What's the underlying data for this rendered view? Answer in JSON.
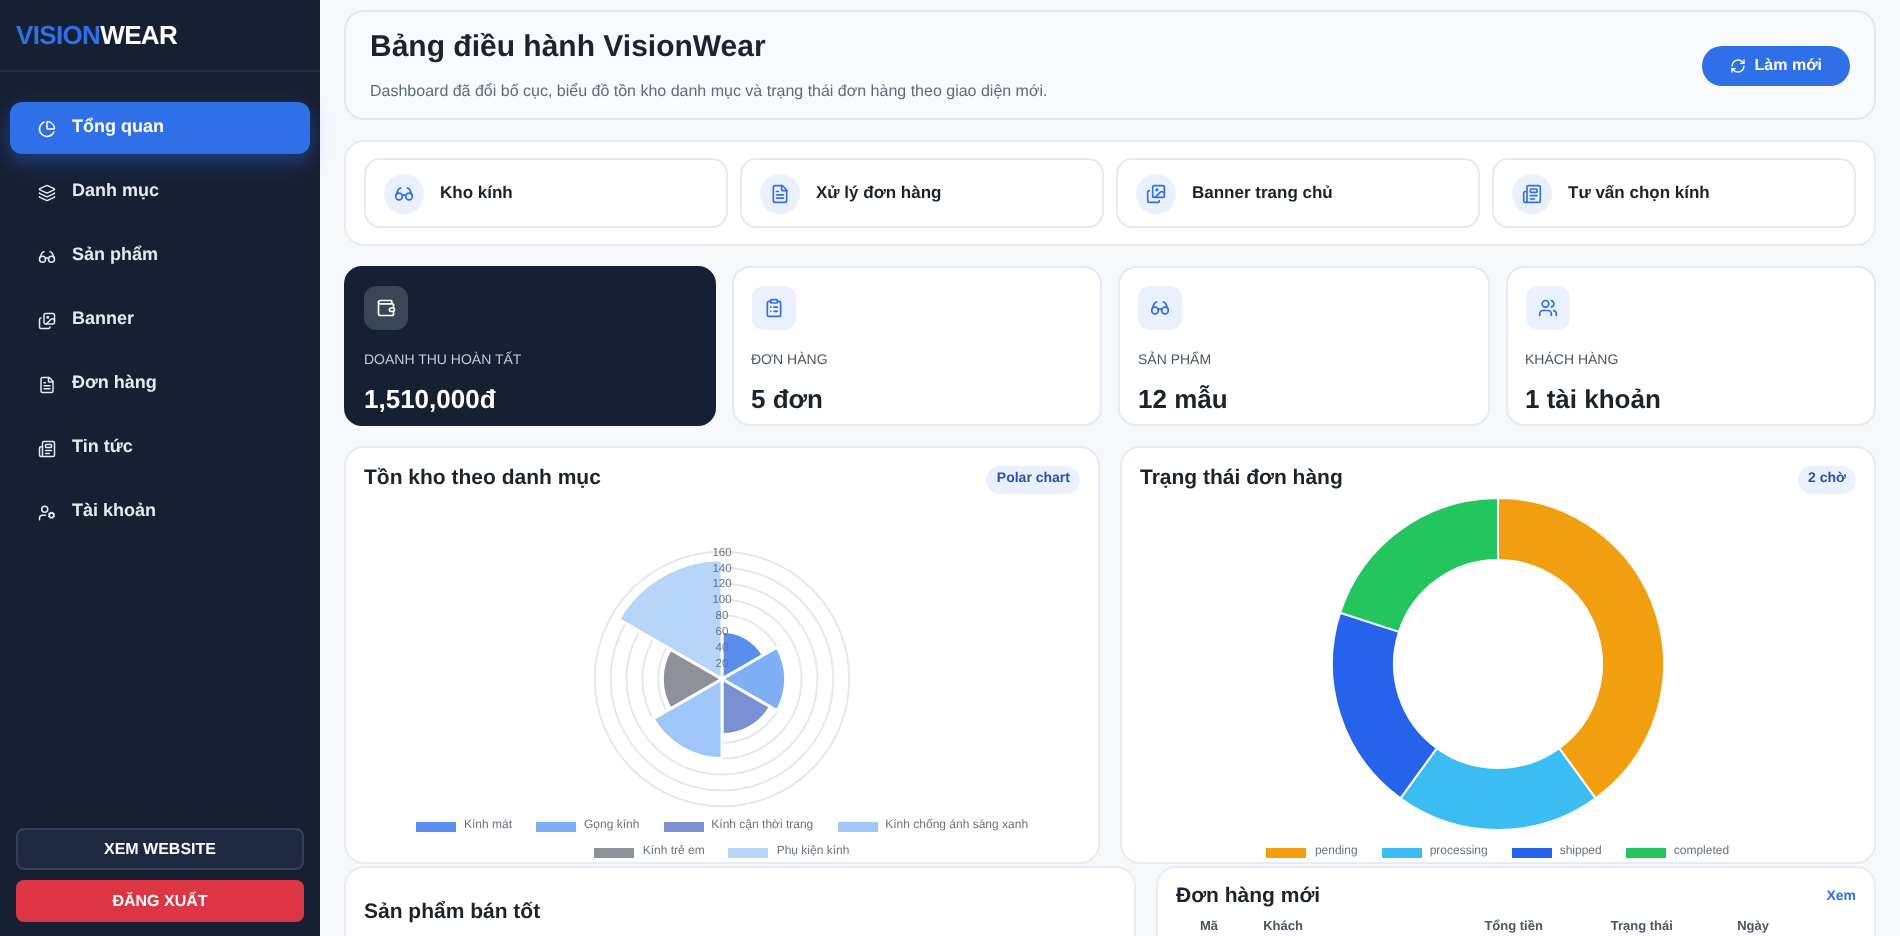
{
  "sidebar": {
    "brand": {
      "part1": "VISION",
      "part2": "WEAR"
    },
    "items": [
      {
        "label": "Tổng quan",
        "selected": true
      },
      {
        "label": "Danh mục",
        "selected": false
      },
      {
        "label": "Sản phẩm",
        "selected": false
      },
      {
        "label": "Banner",
        "selected": false
      },
      {
        "label": "Đơn hàng",
        "selected": false
      },
      {
        "label": "Tin tức",
        "selected": false
      },
      {
        "label": "Tài khoản",
        "selected": false
      }
    ],
    "buttons": [
      {
        "label": "XEM WEBSITE",
        "kind": "secondary"
      },
      {
        "label": "ĐĂNG XUẤT",
        "kind": "danger"
      }
    ]
  },
  "header": {
    "title": "Bảng điều hành VisionWear",
    "subtitle": "Dashboard đã đổi bố cục, biểu đồ tồn kho danh mục và trạng thái đơn hàng theo giao diện mới.",
    "button": "Làm mới"
  },
  "shortcuts": [
    {
      "label": "Kho kính"
    },
    {
      "label": "Xử lý đơn hàng"
    },
    {
      "label": "Banner trang chủ"
    },
    {
      "label": "Tư vấn chọn kính"
    }
  ],
  "stats": [
    {
      "label": "DOANH THU HOÀN TẤT",
      "value": "1,510,000đ",
      "selected": true
    },
    {
      "label": "ĐƠN HÀNG",
      "value": "5 đơn",
      "selected": false
    },
    {
      "label": "SẢN PHẨM",
      "value": "12 mẫu",
      "selected": false
    },
    {
      "label": "KHÁCH HÀNG",
      "value": "1 tài khoản",
      "selected": false
    }
  ],
  "inventory": {
    "title": "Tồn kho theo danh mục",
    "badge": "Polar chart",
    "axis_ticks": [
      "160",
      "140",
      "120",
      "100",
      "80",
      "60",
      "40",
      "20"
    ],
    "legend": [
      {
        "label": "Kính mát",
        "color": "#5b8def"
      },
      {
        "label": "Gọng kính",
        "color": "#7fb0f5"
      },
      {
        "label": "Kính cận thời trang",
        "color": "#7b8fd3"
      },
      {
        "label": "Kính chống ánh sáng xanh",
        "color": "#9fc6f8"
      },
      {
        "label": "Kính trẻ em",
        "color": "#8f9199"
      },
      {
        "label": "Phụ kiện kính",
        "color": "#b6d5f9"
      }
    ]
  },
  "orders_status": {
    "title": "Trạng thái đơn hàng",
    "badge": "2 chờ",
    "chart_data": {
      "type": "donut",
      "categories": [
        "pending",
        "processing",
        "shipped",
        "completed"
      ],
      "series": [
        {
          "values": [
            40,
            20,
            20,
            20
          ]
        }
      ]
    }
  },
  "best_sellers": {
    "title": "Sản phẩm bán tốt"
  },
  "recent_orders": {
    "title": "Đơn hàng mới",
    "link": "Xem",
    "columns": [
      "Mã",
      "Khách",
      "Tổng tiền",
      "Trạng thái",
      "Ngày"
    ]
  }
}
